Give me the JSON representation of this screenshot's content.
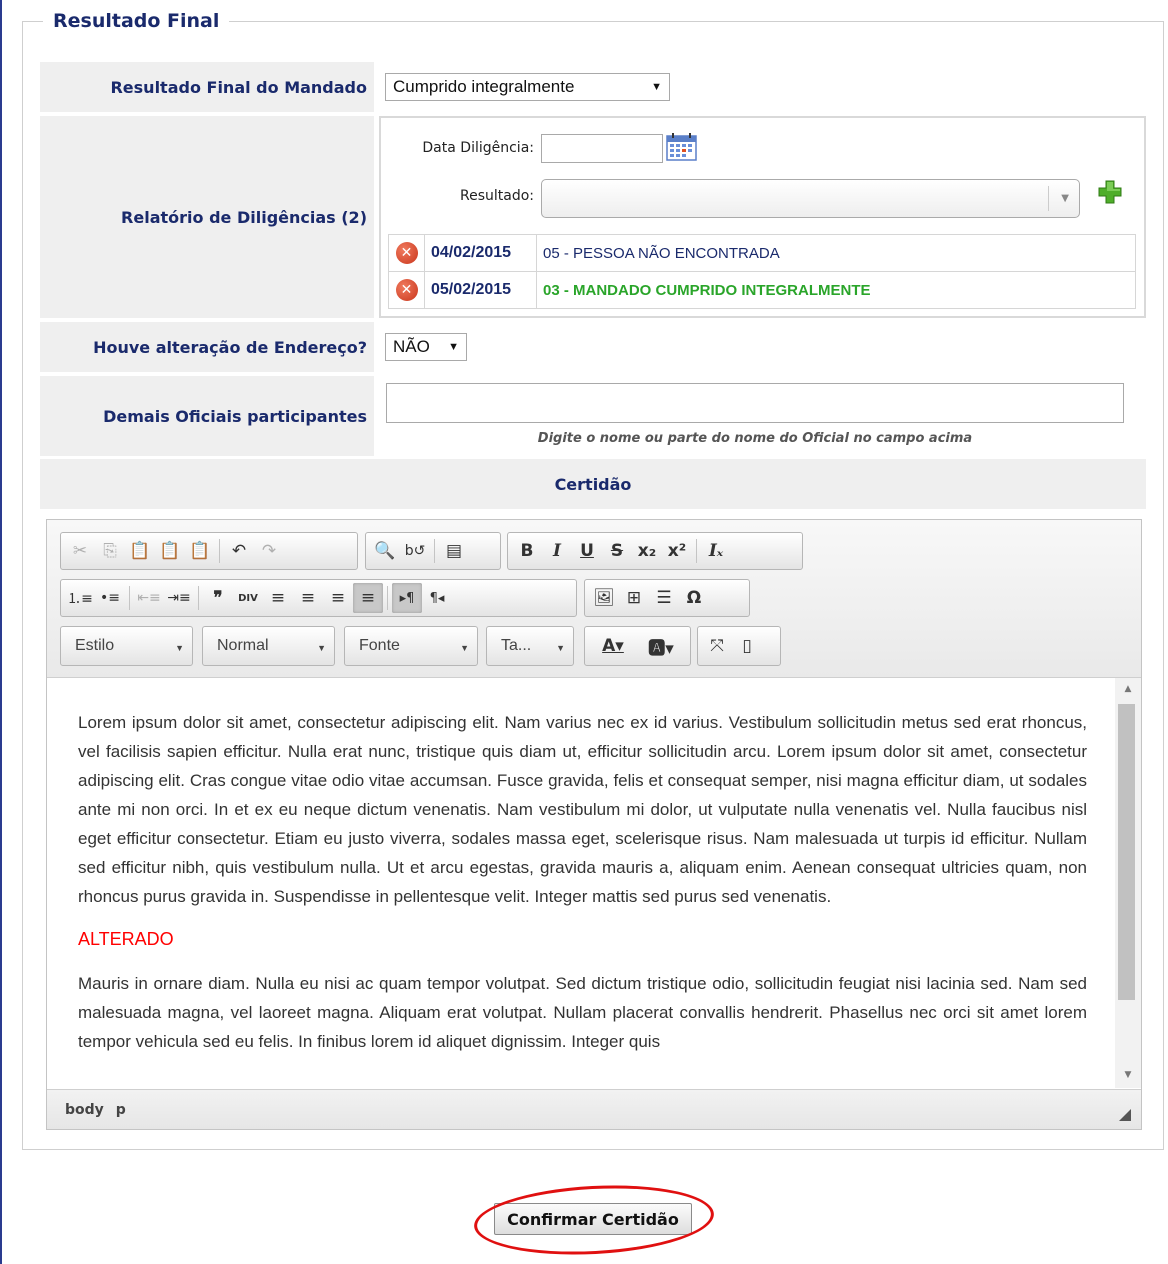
{
  "section": {
    "legend": "Resultado Final"
  },
  "resultado_mandado": {
    "label": "Resultado Final do Mandado",
    "selected": "Cumprido integralmente"
  },
  "relatorio": {
    "label": "Relatório de Diligências (2)",
    "data_label": "Data Diligência:",
    "resultado_label": "Resultado:",
    "entries": [
      {
        "date": "04/02/2015",
        "text": "05 - PESSOA NÃO ENCONTRADA",
        "color": "#1a2a6c"
      },
      {
        "date": "05/02/2015",
        "text": "03 - MANDADO CUMPRIDO INTEGRALMENTE",
        "color": "#2aa52a"
      }
    ]
  },
  "alteracao": {
    "label": "Houve alteração de Endereço?",
    "selected": "NÃO"
  },
  "oficiais": {
    "label": "Demais Oficiais participantes",
    "hint": "Digite o nome ou parte do nome do Oficial no campo acima"
  },
  "certidao": {
    "title": "Certidão",
    "combos": {
      "style": "Estilo",
      "format": "Normal",
      "font": "Fonte",
      "size": "Ta..."
    },
    "paragraphs": [
      "Lorem ipsum dolor sit amet, consectetur adipiscing elit. Nam varius nec ex id varius. Vestibulum sollicitudin metus sed erat rhoncus, vel facilisis sapien efficitur. Nulla erat nunc, tristique quis diam ut, efficitur sollicitudin arcu. Lorem ipsum dolor sit amet, consectetur adipiscing elit. Cras congue vitae odio vitae accumsan. Fusce gravida, felis et consequat semper, nisi magna efficitur diam, ut sodales ante mi non orci. In et ex eu neque dictum venenatis. Nam vestibulum mi dolor, ut vulputate nulla venenatis vel. Nulla faucibus nisl eget efficitur consectetur. Etiam eu justo viverra, sodales massa eget, scelerisque risus. Nam malesuada ut turpis id efficitur. Nullam sed efficitur nibh, quis vestibulum nulla. Ut et arcu egestas, gravida mauris a, aliquam enim. Aenean consequat ultricies quam, non rhoncus purus gravida in. Suspendisse in pellentesque velit. Integer mattis sed purus sed venenatis.",
      "ALTERADO",
      "Mauris in ornare diam. Nulla eu nisi ac quam tempor volutpat. Sed dictum tristique odio, sollicitudin feugiat nisi lacinia sed. Nam sed malesuada magna, vel laoreet magna. Aliquam erat volutpat. Nullam placerat convallis hendrerit. Phasellus nec orci sit amet lorem tempor vehicula sed eu felis. In finibus lorem id aliquet dignissim. Integer quis"
    ],
    "path": [
      "body",
      "p"
    ]
  },
  "confirm": {
    "label": "Confirmar Certidão"
  }
}
